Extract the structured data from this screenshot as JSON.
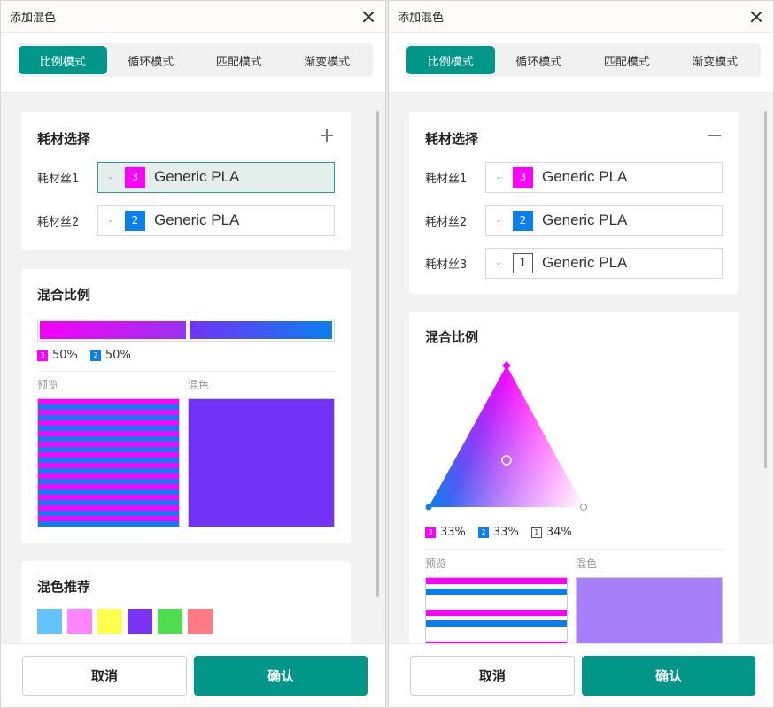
{
  "dialog_left": {
    "title": "添加混色",
    "tabs": [
      {
        "label": "比例模式",
        "active": true
      },
      {
        "label": "循环模式",
        "active": false
      },
      {
        "label": "匹配模式",
        "active": false
      },
      {
        "label": "渐变模式",
        "active": false
      }
    ],
    "filament_section": {
      "title": "耗材选择",
      "action_icon": "plus-icon",
      "rows": [
        {
          "label": "耗材丝1",
          "chip": "3",
          "chip_color": "#ff00ff",
          "name": "Generic PLA",
          "focused": true
        },
        {
          "label": "耗材丝2",
          "chip": "2",
          "chip_color": "#0a7fed",
          "name": "Generic PLA",
          "focused": false
        }
      ]
    },
    "ratio_section": {
      "title": "混合比例",
      "split_fraction": 0.5,
      "percents": [
        {
          "chip": "3",
          "value": "50%"
        },
        {
          "chip": "2",
          "value": "50%"
        }
      ],
      "preview_label": "预览",
      "mix_label": "混色",
      "mix_color": "#7233f7"
    },
    "recommend_section": {
      "title": "混色推荐",
      "swatches": [
        "#66c2ff",
        "#ff85ff",
        "#ffff4d",
        "#7a33f5",
        "#4ddd4d",
        "#ff7a85"
      ]
    },
    "footer": {
      "cancel": "取消",
      "confirm": "确认"
    }
  },
  "dialog_right": {
    "title": "添加混色",
    "tabs": [
      {
        "label": "比例模式",
        "active": true
      },
      {
        "label": "循环模式",
        "active": false
      },
      {
        "label": "匹配模式",
        "active": false
      },
      {
        "label": "渐变模式",
        "active": false
      }
    ],
    "filament_section": {
      "title": "耗材选择",
      "action_icon": "minus-icon",
      "rows": [
        {
          "label": "耗材丝1",
          "chip": "3",
          "chip_color": "#ff00ff",
          "name": "Generic PLA"
        },
        {
          "label": "耗材丝2",
          "chip": "2",
          "chip_color": "#0a7fed",
          "name": "Generic PLA"
        },
        {
          "label": "耗材丝3",
          "chip": "1",
          "chip_color": "#ffffff",
          "name": "Generic PLA"
        }
      ]
    },
    "ratio_section": {
      "title": "混合比例",
      "percents": [
        {
          "chip": "3",
          "value": "33%"
        },
        {
          "chip": "2",
          "value": "33%"
        },
        {
          "chip": "1",
          "value": "34%"
        }
      ],
      "preview_label": "预览",
      "mix_label": "混色",
      "mix_color": "#a77ff8"
    },
    "footer": {
      "cancel": "取消",
      "confirm": "确认"
    }
  }
}
